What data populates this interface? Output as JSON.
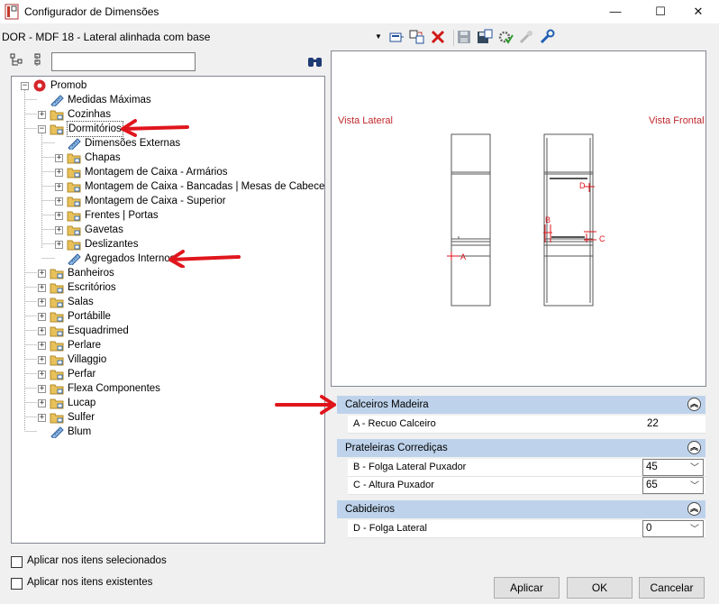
{
  "window": {
    "title": "Configurador de Dimensões",
    "controls": [
      "—",
      "☐",
      "✕"
    ]
  },
  "toolbar": {
    "config_value": "DOR - MDF 18 - Lateral alinhada com base"
  },
  "search": {
    "value": "",
    "placeholder": ""
  },
  "tree": [
    {
      "label": "Promob",
      "level": 0,
      "expander": "−",
      "icon": "promob-logo-icon"
    },
    {
      "label": "Medidas Máximas",
      "level": 1,
      "expander": "",
      "icon": "ruler-icon"
    },
    {
      "label": "Cozinhas",
      "level": 1,
      "expander": "+",
      "icon": "folder-icon"
    },
    {
      "label": "Dormitórios",
      "level": 1,
      "expander": "−",
      "icon": "folder-icon",
      "selected": true
    },
    {
      "label": "Dimensões Externas",
      "level": 2,
      "expander": "",
      "icon": "ruler-icon"
    },
    {
      "label": "Chapas",
      "level": 2,
      "expander": "+",
      "icon": "folder-icon"
    },
    {
      "label": "Montagem de Caixa - Armários",
      "level": 2,
      "expander": "+",
      "icon": "folder-icon"
    },
    {
      "label": "Montagem de Caixa - Bancadas | Mesas de Cabeceira",
      "level": 2,
      "expander": "+",
      "icon": "folder-icon"
    },
    {
      "label": "Montagem de Caixa - Superior",
      "level": 2,
      "expander": "+",
      "icon": "folder-icon"
    },
    {
      "label": "Frentes | Portas",
      "level": 2,
      "expander": "+",
      "icon": "folder-icon"
    },
    {
      "label": "Gavetas",
      "level": 2,
      "expander": "+",
      "icon": "folder-icon"
    },
    {
      "label": "Deslizantes",
      "level": 2,
      "expander": "+",
      "icon": "folder-icon"
    },
    {
      "label": "Agregados Internos",
      "level": 2,
      "expander": "",
      "icon": "ruler-icon"
    },
    {
      "label": "Banheiros",
      "level": 1,
      "expander": "+",
      "icon": "folder-icon"
    },
    {
      "label": "Escritórios",
      "level": 1,
      "expander": "+",
      "icon": "folder-icon"
    },
    {
      "label": "Salas",
      "level": 1,
      "expander": "+",
      "icon": "folder-icon"
    },
    {
      "label": "Portábille",
      "level": 1,
      "expander": "+",
      "icon": "folder-icon"
    },
    {
      "label": "Esquadrimed",
      "level": 1,
      "expander": "+",
      "icon": "folder-icon"
    },
    {
      "label": "Perlare",
      "level": 1,
      "expander": "+",
      "icon": "folder-icon"
    },
    {
      "label": "Villaggio",
      "level": 1,
      "expander": "+",
      "icon": "folder-icon"
    },
    {
      "label": "Perfar",
      "level": 1,
      "expander": "+",
      "icon": "folder-icon"
    },
    {
      "label": "Flexa Componentes",
      "level": 1,
      "expander": "+",
      "icon": "folder-icon"
    },
    {
      "label": "Lucap",
      "level": 1,
      "expander": "+",
      "icon": "folder-icon"
    },
    {
      "label": "Sulfer",
      "level": 1,
      "expander": "+",
      "icon": "folder-icon"
    },
    {
      "label": "Blum",
      "level": 1,
      "expander": "",
      "icon": "ruler-icon"
    }
  ],
  "preview": {
    "left_label": "Vista Lateral",
    "right_label": "Vista Frontal",
    "markers": {
      "a": "A",
      "b": "B",
      "c": "C",
      "d": "D"
    }
  },
  "groups": {
    "calceiros": {
      "title": "Calceiros Madeira",
      "props": [
        {
          "name": "A - Recuo Calceiro",
          "value": "22"
        }
      ]
    },
    "prateleiras": {
      "title": "Prateleiras Corrediças",
      "props": [
        {
          "name": "B - Folga Lateral Puxador",
          "value": "45"
        },
        {
          "name": "C - Altura Puxador",
          "value": "65"
        }
      ]
    },
    "cabideiros": {
      "title": "Cabideiros",
      "props": [
        {
          "name": "D - Folga Lateral",
          "value": "0"
        }
      ]
    }
  },
  "options": {
    "apply_selected": "Aplicar nos itens selecionados",
    "apply_existing": "Aplicar nos itens existentes"
  },
  "buttons": {
    "apply": "Aplicar",
    "ok": "OK",
    "cancel": "Cancelar"
  },
  "colors": {
    "header_band": "#bed3eb",
    "annotation_red": "#e0151c",
    "view_label": "#c1272d",
    "folder": "#e8c15a"
  }
}
